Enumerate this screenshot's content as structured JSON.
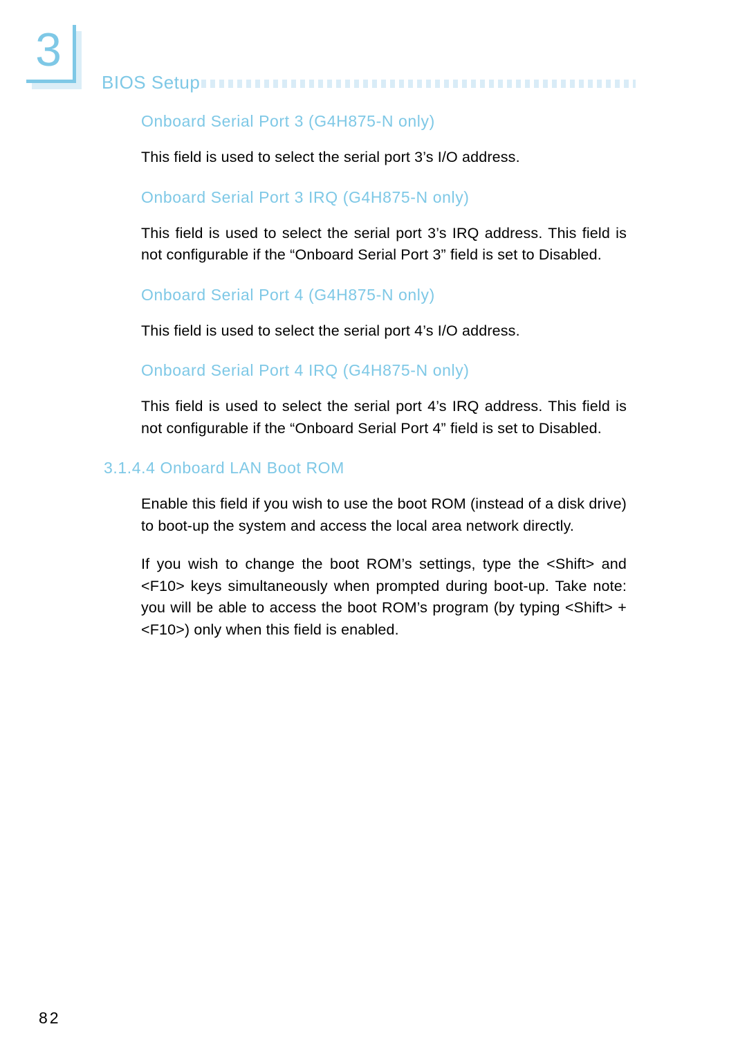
{
  "header": {
    "chapter_number": "3",
    "title": "BIOS Setup",
    "rule_icon": "dotted-square-rule"
  },
  "colors": {
    "accent_blue": "#7ec8e6",
    "rule_blue": "#d9ecf7",
    "plate_shadow": "#dbeef7",
    "body_text": "#000000"
  },
  "content": {
    "blocks": [
      {
        "heading": "Onboard Serial Port 3 (G4H875-N only)",
        "paragraphs": [
          "This field is used to select the serial port 3’s I/O address."
        ]
      },
      {
        "heading": "Onboard Serial Port 3 IRQ (G4H875-N only)",
        "paragraphs": [
          "This field is used to select the serial port 3’s IRQ address. This field is not configurable if the “Onboard Serial Port 3” field is set to Disabled."
        ]
      },
      {
        "heading": "Onboard Serial Port 4 (G4H875-N only)",
        "paragraphs": [
          "This field is used to select the serial port 4’s I/O address."
        ]
      },
      {
        "heading": "Onboard Serial Port 4 IRQ (G4H875-N only)",
        "paragraphs": [
          "This field is used to select the serial port 4’s IRQ address. This field is not configurable if the “Onboard Serial Port 4” field is set to Disabled."
        ]
      },
      {
        "heading": "3.1.4.4  Onboard LAN Boot ROM",
        "paragraphs": [
          "Enable this field if you wish to use the boot ROM (instead of a disk drive) to boot-up the system and access the local area network directly.",
          "If you wish to change the boot ROM’s settings, type the <Shift> and <F10> keys simultaneously when prompted during boot-up. Take note: you will be able to access the boot ROM’s program (by typing <Shift> + <F10>) only when this field is enabled."
        ]
      }
    ]
  },
  "footer": {
    "page_number": "82"
  }
}
